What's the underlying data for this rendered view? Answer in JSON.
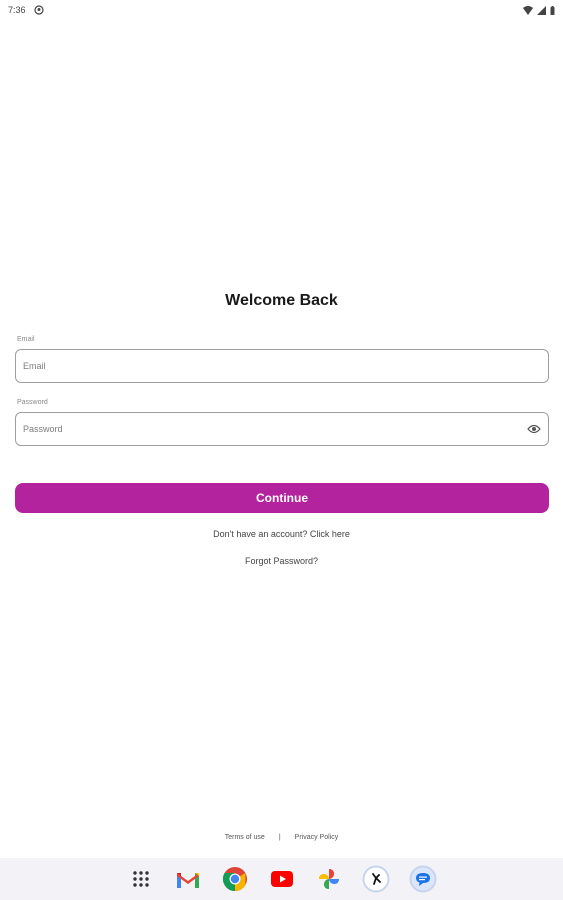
{
  "status_bar": {
    "time": "7:36"
  },
  "login": {
    "title": "Welcome Back",
    "email_label": "Email",
    "email_placeholder": "Email",
    "password_label": "Password",
    "password_placeholder": "Password",
    "continue_label": "Continue",
    "signup_link": "Don't have an account? Click here",
    "forgot_link": "Forgot Password?"
  },
  "footer": {
    "terms": "Terms of use",
    "separator": "|",
    "privacy": "Privacy Policy"
  },
  "dock": {
    "apps": [
      "apps-grid-icon",
      "gmail-icon",
      "chrome-icon",
      "youtube-icon",
      "photos-icon",
      "app-icon",
      "messages-icon"
    ]
  },
  "colors": {
    "accent": "#b3239d"
  }
}
